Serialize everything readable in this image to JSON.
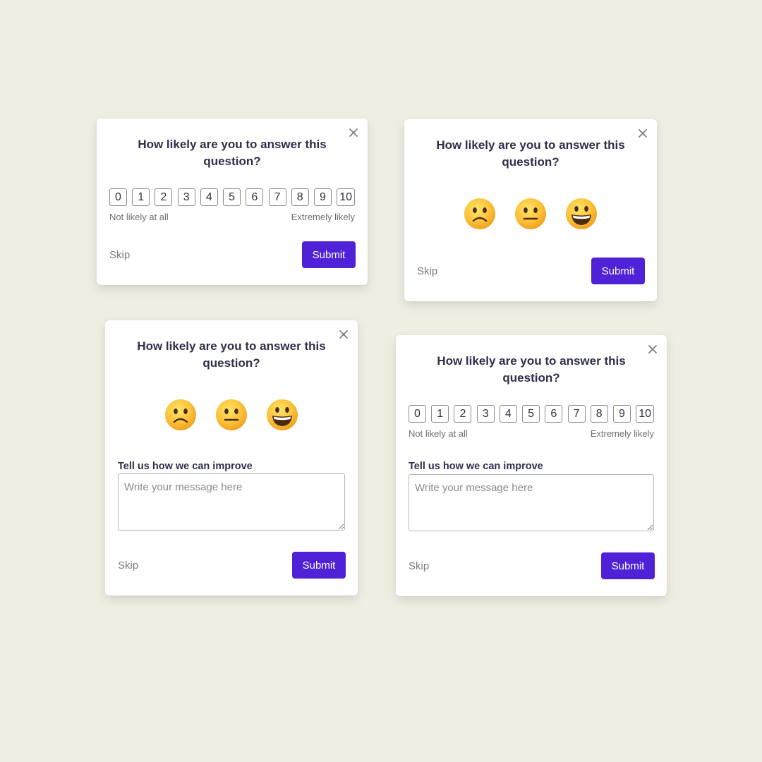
{
  "colors": {
    "background": "#efeee3",
    "accent": "#4f22d8",
    "card": "#ffffff",
    "text": "#2e2f48",
    "muted": "#7b7b7b"
  },
  "icons": {
    "close": "close-icon",
    "sad": "slightly-frowning-face-icon",
    "neutral": "neutral-face-icon",
    "happy": "grinning-face-icon"
  },
  "cards": [
    {
      "question": "How likely are you to answer this question?",
      "scale": [
        "0",
        "1",
        "2",
        "3",
        "4",
        "5",
        "6",
        "7",
        "8",
        "9",
        "10"
      ],
      "scale_low_label": "Not likely at all",
      "scale_high_label": "Extremely likely",
      "skip_label": "Skip",
      "submit_label": "Submit"
    },
    {
      "question": "How likely are you to answer this question?",
      "skip_label": "Skip",
      "submit_label": "Submit"
    },
    {
      "question": "How likely are you to answer this question?",
      "feedback_label": "Tell us how we can improve",
      "feedback_placeholder": "Write your message here",
      "skip_label": "Skip",
      "submit_label": "Submit"
    },
    {
      "question": "How likely are you to answer this question?",
      "scale": [
        "0",
        "1",
        "2",
        "3",
        "4",
        "5",
        "6",
        "7",
        "8",
        "9",
        "10"
      ],
      "scale_low_label": "Not likely at all",
      "scale_high_label": "Extremely likely",
      "feedback_label": "Tell us how we can improve",
      "feedback_placeholder": "Write your message here",
      "skip_label": "Skip",
      "submit_label": "Submit"
    }
  ]
}
